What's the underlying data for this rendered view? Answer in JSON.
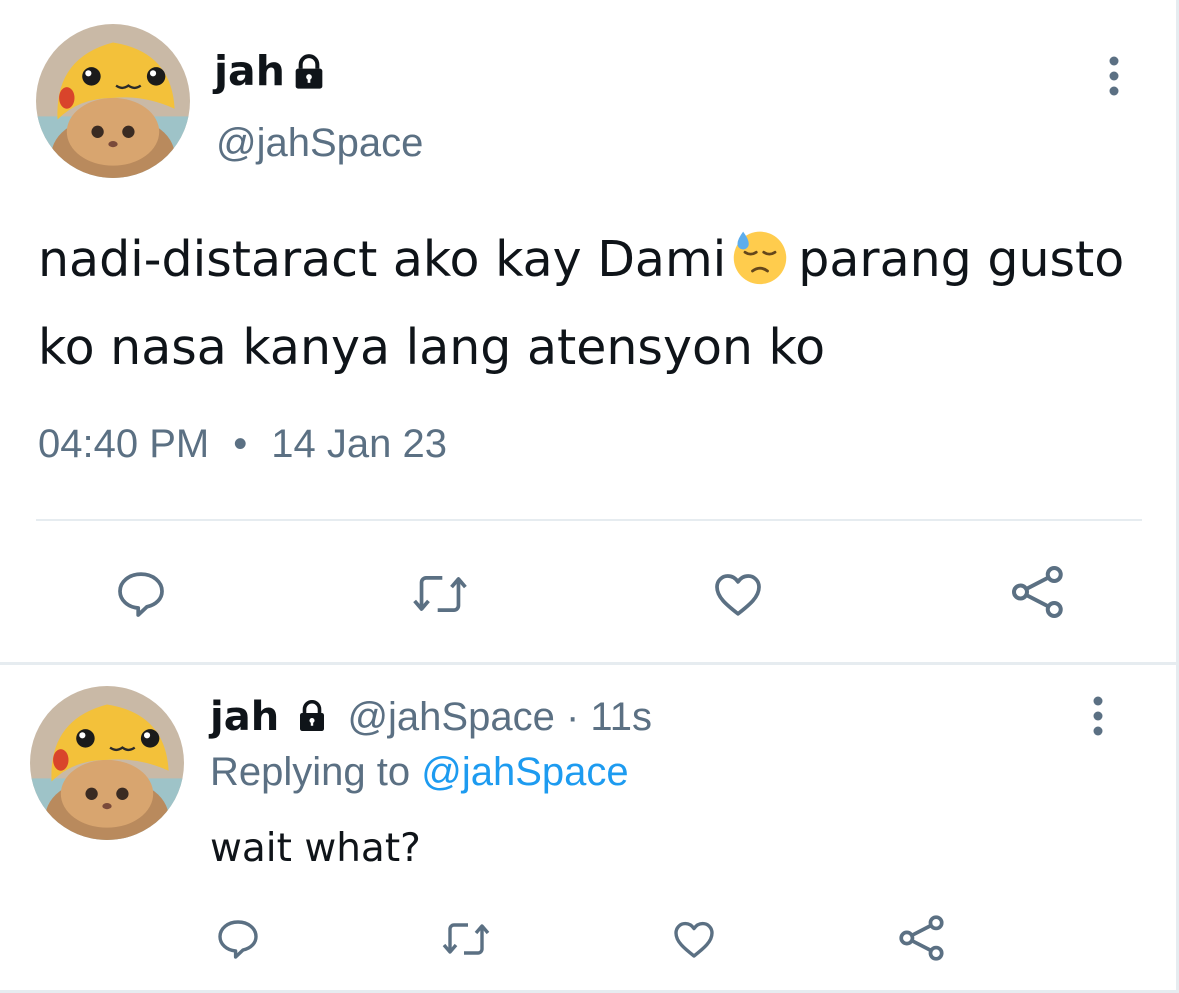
{
  "main_tweet": {
    "author_name": "jah",
    "author_handle": "@jahSpace",
    "text_before_emoji": "nadi-distaract ako kay Dami",
    "emoji": "downcast-face-with-sweat",
    "text_after_emoji": "parang gusto ko nasa kanya lang atensyon ko",
    "time": "04:40 PM",
    "separator": "•",
    "date": "14 Jan 23"
  },
  "reply": {
    "author_name": "jah",
    "author_handle": "@jahSpace",
    "dot": "·",
    "age": "11s",
    "replying_label": "Replying to",
    "replying_mention": "@jahSpace",
    "text": "wait what?"
  },
  "icons": {
    "lock": "lock-icon",
    "more": "more-vertical-icon",
    "reply": "reply-icon",
    "retweet": "retweet-icon",
    "like": "heart-icon",
    "share": "share-icon"
  },
  "colors": {
    "text": "#0f1419",
    "secondary": "#5b7083",
    "link": "#1d9bf0",
    "divider": "#e6ecf0"
  }
}
